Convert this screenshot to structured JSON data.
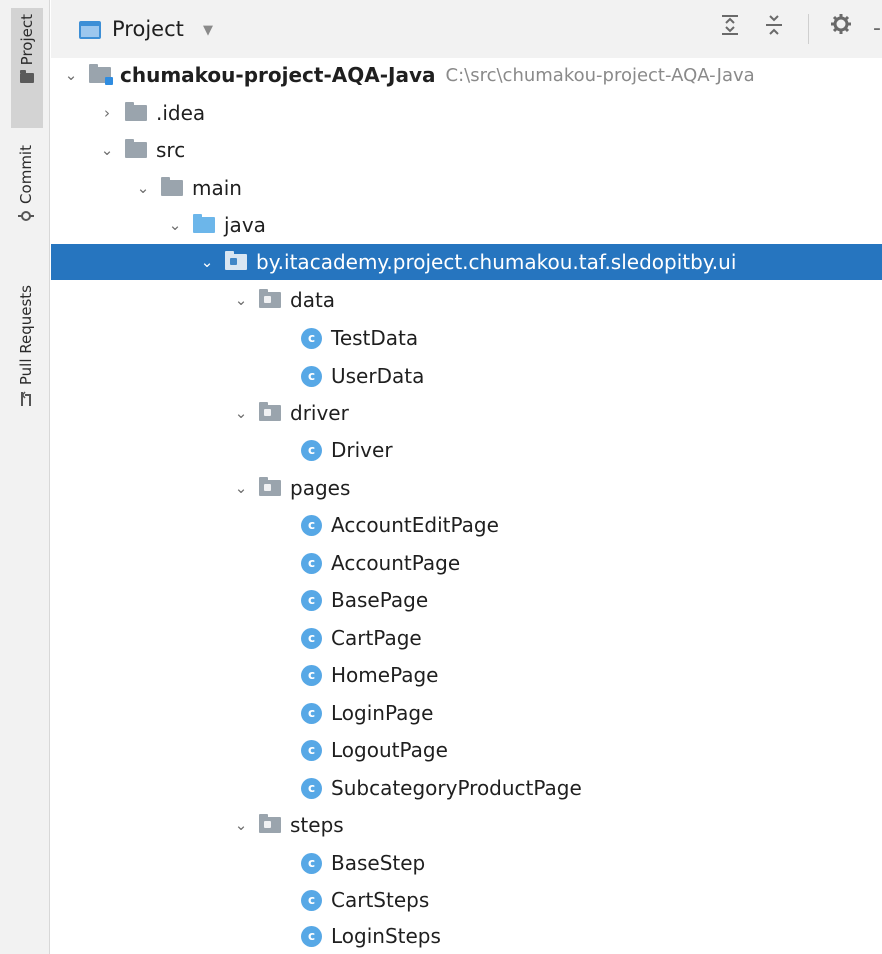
{
  "strip": {
    "tabs": [
      {
        "label": "Project",
        "icon": "folder-icon"
      },
      {
        "label": "Commit",
        "icon": "commit-icon"
      },
      {
        "label": "Pull Requests",
        "icon": "pull-request-icon"
      }
    ]
  },
  "header": {
    "title": "Project",
    "dropdown_icon": "▼",
    "expand_icon": "⩮",
    "collapse_icon": "⩯",
    "settings_icon": "✿",
    "hide_icon": "-"
  },
  "tree": {
    "root": {
      "label": "chumakou-project-AQA-Java",
      "path": "C:\\src\\chumakou-project-AQA-Java",
      "chevron": "⌄"
    },
    "idea": {
      "label": ".idea",
      "chevron": "›"
    },
    "src": {
      "label": "src",
      "chevron": "⌄"
    },
    "main": {
      "label": "main",
      "chevron": "⌄"
    },
    "java": {
      "label": "java",
      "chevron": "⌄"
    },
    "package": {
      "label": "by.itacademy.project.chumakou.taf.sledopitby.ui",
      "chevron": "⌄"
    },
    "data": {
      "label": "data",
      "chevron": "⌄"
    },
    "testdata": {
      "label": "TestData",
      "badge": "c"
    },
    "userdata": {
      "label": "UserData",
      "badge": "c"
    },
    "driver_pkg": {
      "label": "driver",
      "chevron": "⌄"
    },
    "driver_cls": {
      "label": "Driver",
      "badge": "c"
    },
    "pages": {
      "label": "pages",
      "chevron": "⌄"
    },
    "accounteditpage": {
      "label": "AccountEditPage",
      "badge": "c"
    },
    "accountpage": {
      "label": "AccountPage",
      "badge": "c"
    },
    "basepage": {
      "label": "BasePage",
      "badge": "c"
    },
    "cartpage": {
      "label": "CartPage",
      "badge": "c"
    },
    "homepage": {
      "label": "HomePage",
      "badge": "c"
    },
    "loginpage": {
      "label": "LoginPage",
      "badge": "c"
    },
    "logoutpage": {
      "label": "LogoutPage",
      "badge": "c"
    },
    "subcategoryproductpage": {
      "label": "SubcategoryProductPage",
      "badge": "c"
    },
    "steps": {
      "label": "steps",
      "chevron": "⌄"
    },
    "basestep": {
      "label": "BaseStep",
      "badge": "c"
    },
    "cartsteps": {
      "label": "CartSteps",
      "badge": "c"
    },
    "loginsteps": {
      "label": "LoginSteps",
      "badge": "c"
    }
  },
  "colors": {
    "selection": "#2675bf",
    "class_badge": "#57a8e6",
    "folder_grey": "#9aa4ad",
    "source_folder_blue": "#6cb6ea"
  }
}
